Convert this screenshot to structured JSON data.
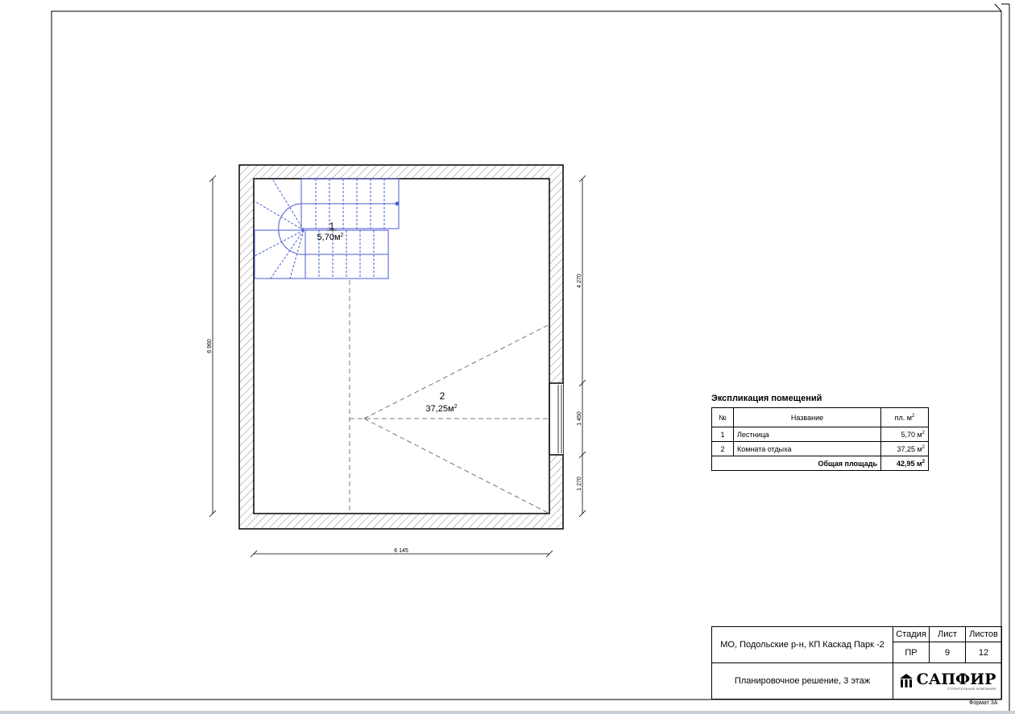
{
  "plan": {
    "dim_height_total": "6 960",
    "dim_width": "6 145",
    "dim_right_top": "4 270",
    "dim_right_mid": "1 450",
    "dim_right_bottom": "1 270",
    "rooms": [
      {
        "number": "1",
        "area": "5,70м",
        "sup": "2"
      },
      {
        "number": "2",
        "area": "37,25м",
        "sup": "2"
      }
    ]
  },
  "explication": {
    "title": "Экспликация помещений",
    "header": {
      "num": "№",
      "name": "Название",
      "area": "пл. м",
      "area_sup": "2"
    },
    "rows": [
      {
        "num": "1",
        "name": "Лестница",
        "area": "5,70 м",
        "sup": "2"
      },
      {
        "num": "2",
        "name": "Комната отдыха",
        "area": "37,25 м",
        "sup": "2"
      }
    ],
    "total_label": "Общая площадь",
    "total_value": "42,95 м",
    "total_sup": "2"
  },
  "stamp": {
    "address": "МО, Подольские р-н, КП Каскад Парк -2",
    "stage_label": "Стадия",
    "sheet_label": "Лист",
    "sheets_label": "Листов",
    "stage": "ПР",
    "sheet": "9",
    "sheets": "12",
    "drawing_title": "Планировочное решение, 3 этаж",
    "logo": "САПФИР",
    "logo_sub": "СТРОИТЕЛЬНАЯ КОМПАНИЯ"
  },
  "format_label": "Формат 3А",
  "colors": {
    "stair": "#4a5bd6",
    "line": "#000000",
    "dash": "#555555",
    "hatch": "#888888"
  }
}
